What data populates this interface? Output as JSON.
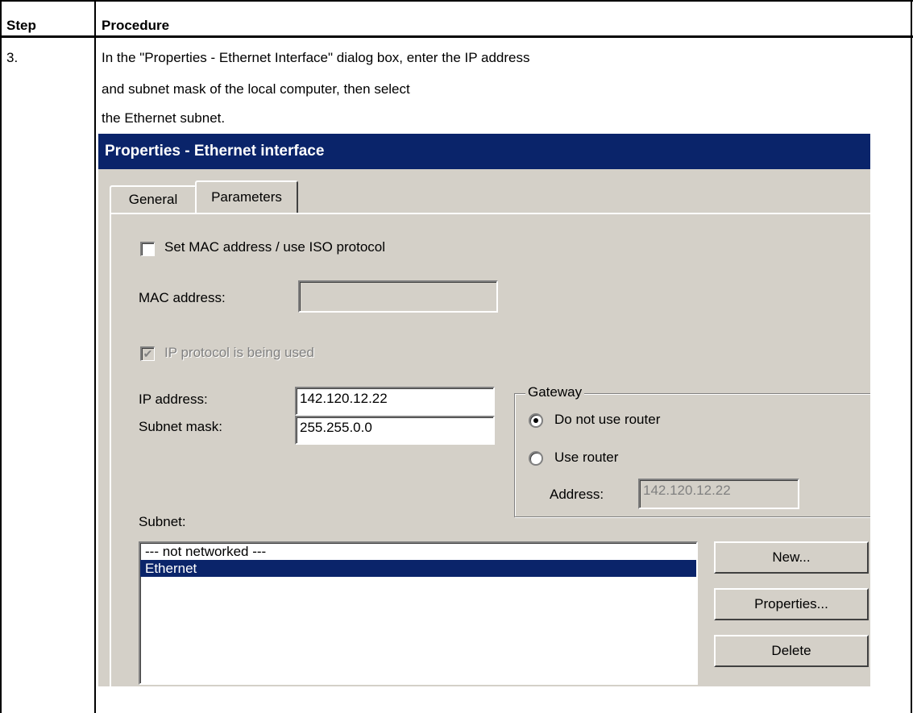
{
  "table": {
    "header_step": "Step",
    "header_procedure": "Procedure",
    "step_number": "3.",
    "instruction_lines": [
      "In the \"Properties - Ethernet Interface\" dialog box, enter the IP address",
      "and subnet mask of the local computer, then select",
      "the Ethernet subnet."
    ]
  },
  "dialog": {
    "title": "Properties - Ethernet interface",
    "tabs": [
      "General",
      "Parameters"
    ],
    "active_tab": "Parameters",
    "mac_checkbox_label": "Set MAC address / use ISO protocol",
    "mac_checked": false,
    "mac_label": "MAC address:",
    "mac_value": "",
    "ip_checkbox_label": "IP protocol is being used",
    "ip_checked": true,
    "ip_label": "IP address:",
    "ip_value": "142.120.12.22",
    "subnet_mask_label": "Subnet mask:",
    "subnet_mask_value": "255.255.0.0",
    "gateway": {
      "title": "Gateway",
      "option_no_router": "Do not use router",
      "option_use_router": "Use router",
      "selected": "Do not use router",
      "address_label": "Address:",
      "address_value": "142.120.12.22"
    },
    "subnet_label": "Subnet:",
    "subnet_items": [
      "--- not networked ---",
      "Ethernet"
    ],
    "subnet_selected": "Ethernet",
    "buttons": {
      "new": "New...",
      "properties": "Properties...",
      "delete": "Delete"
    }
  },
  "colors": {
    "titlebar": "#0a246a",
    "dialog_bg": "#d4d0c8",
    "selection": "#0a246a"
  }
}
